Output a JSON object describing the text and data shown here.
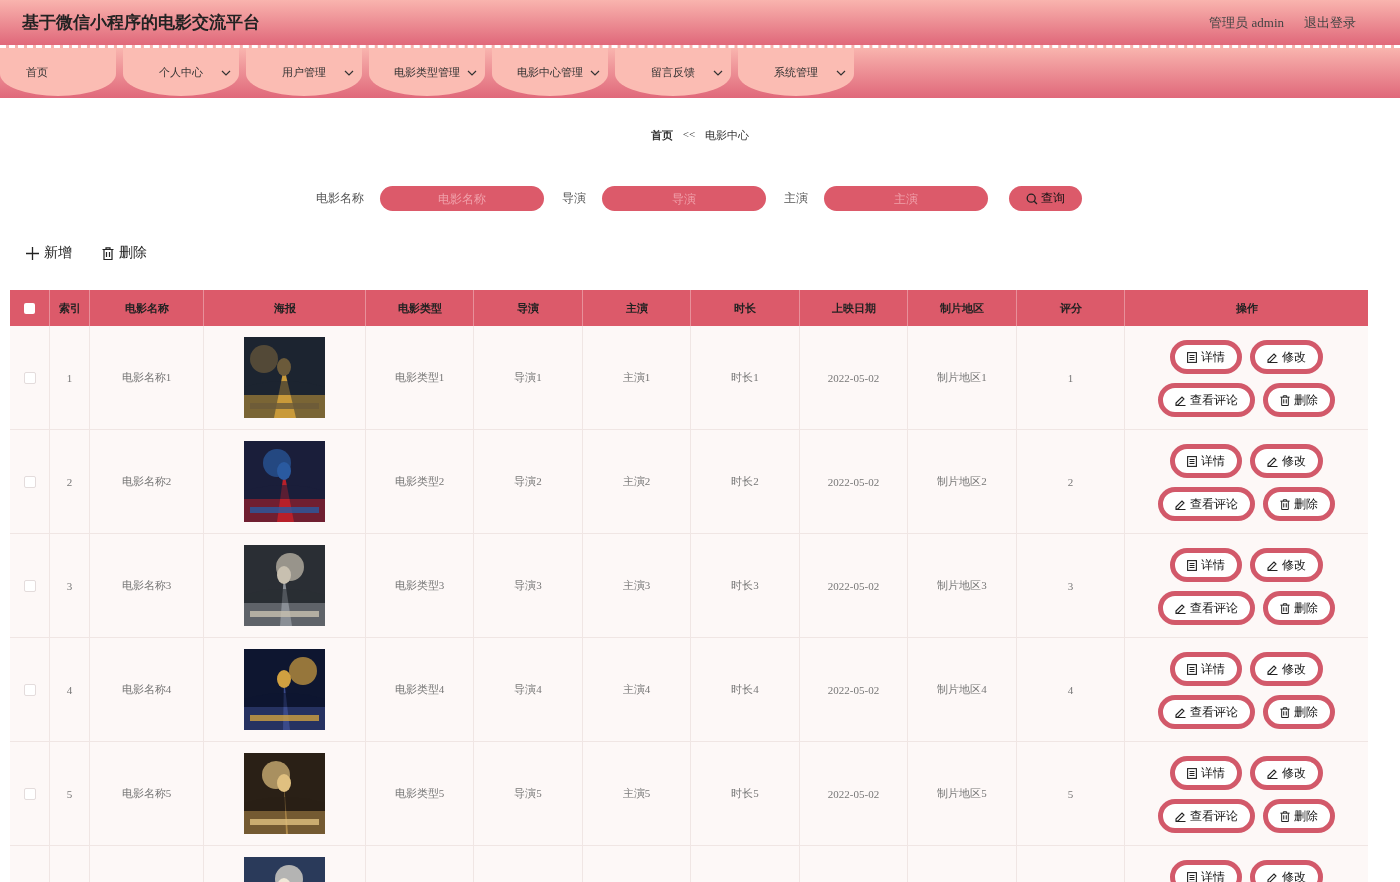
{
  "header": {
    "title": "基于微信小程序的电影交流平台",
    "user": "管理员 admin",
    "logout": "退出登录"
  },
  "nav": [
    {
      "label": "首页",
      "has_menu": false
    },
    {
      "label": "个人中心",
      "has_menu": true
    },
    {
      "label": "用户管理",
      "has_menu": true
    },
    {
      "label": "电影类型管理",
      "has_menu": true
    },
    {
      "label": "电影中心管理",
      "has_menu": true
    },
    {
      "label": "留言反馈",
      "has_menu": true
    },
    {
      "label": "系统管理",
      "has_menu": true
    }
  ],
  "breadcrumb": {
    "home": "首页",
    "separator": "<<",
    "current": "电影中心"
  },
  "search": {
    "fields": [
      {
        "label": "电影名称",
        "placeholder": "电影名称"
      },
      {
        "label": "导演",
        "placeholder": "导演"
      },
      {
        "label": "主演",
        "placeholder": "主演"
      }
    ],
    "button": "查询"
  },
  "toolbar": [
    {
      "kind": "add",
      "label": "新增"
    },
    {
      "kind": "delete",
      "label": "删除"
    }
  ],
  "table": {
    "select_all_checked": false,
    "columns": [
      "索引",
      "电影名称",
      "海报",
      "电影类型",
      "导演",
      "主演",
      "时长",
      "上映日期",
      "制片地区",
      "评分",
      "操作"
    ],
    "rows": [
      {
        "checked": false,
        "cells": [
          "1",
          "电影名称1",
          null,
          "电影类型1",
          "导演1",
          "主演1",
          "时长1",
          "2022-05-02",
          "制片地区1",
          "1"
        ],
        "actions": [
          {
            "kind": "detail",
            "label": "详情"
          },
          {
            "kind": "edit",
            "label": "修改"
          },
          {
            "kind": "comments",
            "label": "查看评论"
          },
          {
            "kind": "delete",
            "label": "删除"
          }
        ]
      },
      {
        "checked": false,
        "cells": [
          "2",
          "电影名称2",
          null,
          "电影类型2",
          "导演2",
          "主演2",
          "时长2",
          "2022-05-02",
          "制片地区2",
          "2"
        ],
        "actions": [
          {
            "kind": "detail",
            "label": "详情"
          },
          {
            "kind": "edit",
            "label": "修改"
          },
          {
            "kind": "comments",
            "label": "查看评论"
          },
          {
            "kind": "delete",
            "label": "删除"
          }
        ]
      },
      {
        "checked": false,
        "cells": [
          "3",
          "电影名称3",
          null,
          "电影类型3",
          "导演3",
          "主演3",
          "时长3",
          "2022-05-02",
          "制片地区3",
          "3"
        ],
        "actions": [
          {
            "kind": "detail",
            "label": "详情"
          },
          {
            "kind": "edit",
            "label": "修改"
          },
          {
            "kind": "comments",
            "label": "查看评论"
          },
          {
            "kind": "delete",
            "label": "删除"
          }
        ]
      },
      {
        "checked": false,
        "cells": [
          "4",
          "电影名称4",
          null,
          "电影类型4",
          "导演4",
          "主演4",
          "时长4",
          "2022-05-02",
          "制片地区4",
          "4"
        ],
        "actions": [
          {
            "kind": "detail",
            "label": "详情"
          },
          {
            "kind": "edit",
            "label": "修改"
          },
          {
            "kind": "comments",
            "label": "查看评论"
          },
          {
            "kind": "delete",
            "label": "删除"
          }
        ]
      },
      {
        "checked": false,
        "cells": [
          "5",
          "电影名称5",
          null,
          "电影类型5",
          "导演5",
          "主演5",
          "时长5",
          "2022-05-02",
          "制片地区5",
          "5"
        ],
        "actions": [
          {
            "kind": "detail",
            "label": "详情"
          },
          {
            "kind": "edit",
            "label": "修改"
          },
          {
            "kind": "comments",
            "label": "查看评论"
          },
          {
            "kind": "delete",
            "label": "删除"
          }
        ]
      },
      {
        "cells": [
          null,
          null,
          null,
          null,
          null,
          null,
          null,
          null,
          null,
          null
        ],
        "actions": [
          {
            "kind": "detail",
            "label": "详情"
          },
          {
            "kind": "edit",
            "label": "修改"
          }
        ]
      }
    ]
  }
}
